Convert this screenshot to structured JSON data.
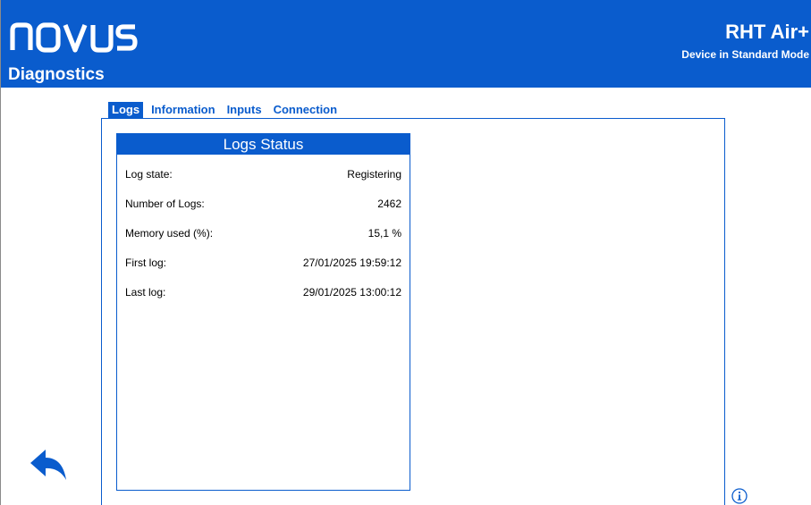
{
  "header": {
    "logo_text": "novus",
    "app_title": "Diagnostics",
    "device_name": "RHT Air+",
    "device_mode": "Device in Standard Mode"
  },
  "tabs": [
    {
      "label": "Logs",
      "active": true
    },
    {
      "label": "Information",
      "active": false
    },
    {
      "label": "Inputs",
      "active": false
    },
    {
      "label": "Connection",
      "active": false
    }
  ],
  "logs_status": {
    "title": "Logs Status",
    "rows": [
      {
        "label": "Log state:",
        "value": "Registering"
      },
      {
        "label": "Number of Logs:",
        "value": "2462"
      },
      {
        "label": "Memory used (%):",
        "value": "15,1 %"
      },
      {
        "label": "First log:",
        "value": "27/01/2025 19:59:12"
      },
      {
        "label": "Last log:",
        "value": "29/01/2025 13:00:12"
      }
    ]
  },
  "icons": {
    "back": "back-arrow-icon",
    "info": "info-icon"
  },
  "colors": {
    "brand_blue": "#0a5ccd",
    "text": "#000000",
    "background": "#ffffff"
  }
}
